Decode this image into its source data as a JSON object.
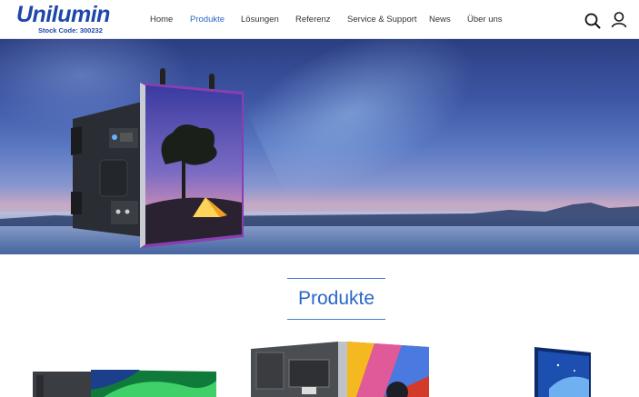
{
  "logo": {
    "wordmark": "Unilumin",
    "stock_code": "Stock Code: 300232"
  },
  "nav": {
    "items": [
      {
        "label": "Home",
        "active": false
      },
      {
        "label": "Produkte",
        "active": true
      },
      {
        "label": "Lösungen",
        "active": false
      },
      {
        "label": "Referenz",
        "active": false
      },
      {
        "label": "Service & Support",
        "active": false
      },
      {
        "label": "News",
        "active": false
      },
      {
        "label": "Über uns",
        "active": false
      }
    ]
  },
  "header_icons": [
    "search-icon",
    "user-icon"
  ],
  "section": {
    "title": "Produkte"
  },
  "colors": {
    "brand": "#1f47a8",
    "accent": "#2b66c8",
    "nav_text": "#333333"
  }
}
